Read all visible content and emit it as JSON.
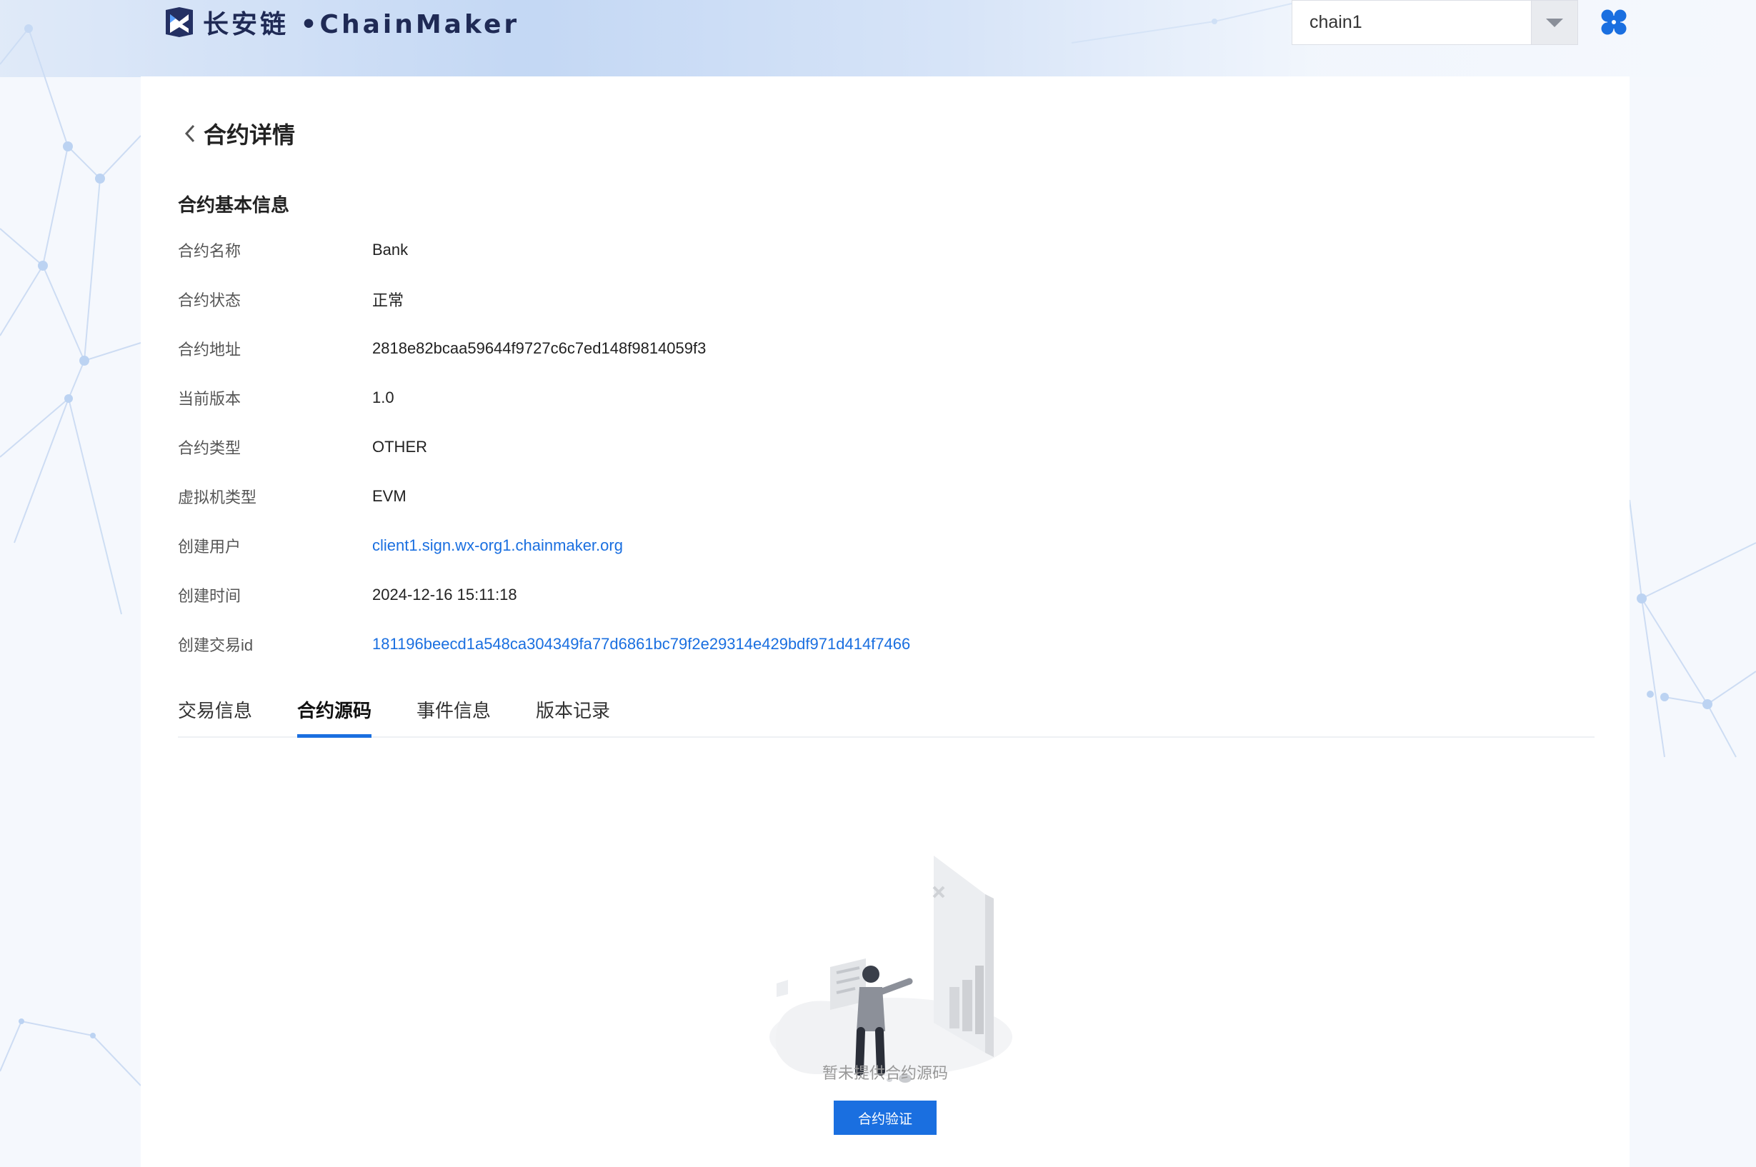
{
  "header": {
    "logo_text": "长安链 •ChainMaker",
    "chain_select": {
      "value": "chain1"
    }
  },
  "page": {
    "title": "合约详情",
    "section_title": "合约基本信息"
  },
  "info": [
    {
      "label": "合约名称",
      "value": "Bank"
    },
    {
      "label": "合约状态",
      "value": "正常"
    },
    {
      "label": "合约地址",
      "value": "2818e82bcaa59644f9727c6c7ed148f9814059f3"
    },
    {
      "label": "当前版本",
      "value": "1.0"
    },
    {
      "label": "合约类型",
      "value": "OTHER"
    },
    {
      "label": "虚拟机类型",
      "value": "EVM"
    },
    {
      "label": "创建用户",
      "value": "client1.sign.wx-org1.chainmaker.org"
    },
    {
      "label": "创建时间",
      "value": "2024-12-16 15:11:18"
    },
    {
      "label": "创建交易id",
      "value": "181196beecd1a548ca304349fa77d6861bc79f2e29314e429bdf971d414f7466"
    }
  ],
  "tabs": [
    {
      "label": "交易信息",
      "active": false
    },
    {
      "label": "合约源码",
      "active": true
    },
    {
      "label": "事件信息",
      "active": false
    },
    {
      "label": "版本记录",
      "active": false
    }
  ],
  "empty_state": {
    "text": "暂未提供合约源码",
    "button_label": "合约验证"
  },
  "colors": {
    "accent": "#1a6fe0",
    "background": "#f5f8fd",
    "logo": "#1f2a55"
  },
  "icons": {
    "back": "chevron-left-icon",
    "select_arrow": "caret-down-icon",
    "apps": "apps-grid-icon",
    "logo": "chainmaker-logo-icon"
  }
}
